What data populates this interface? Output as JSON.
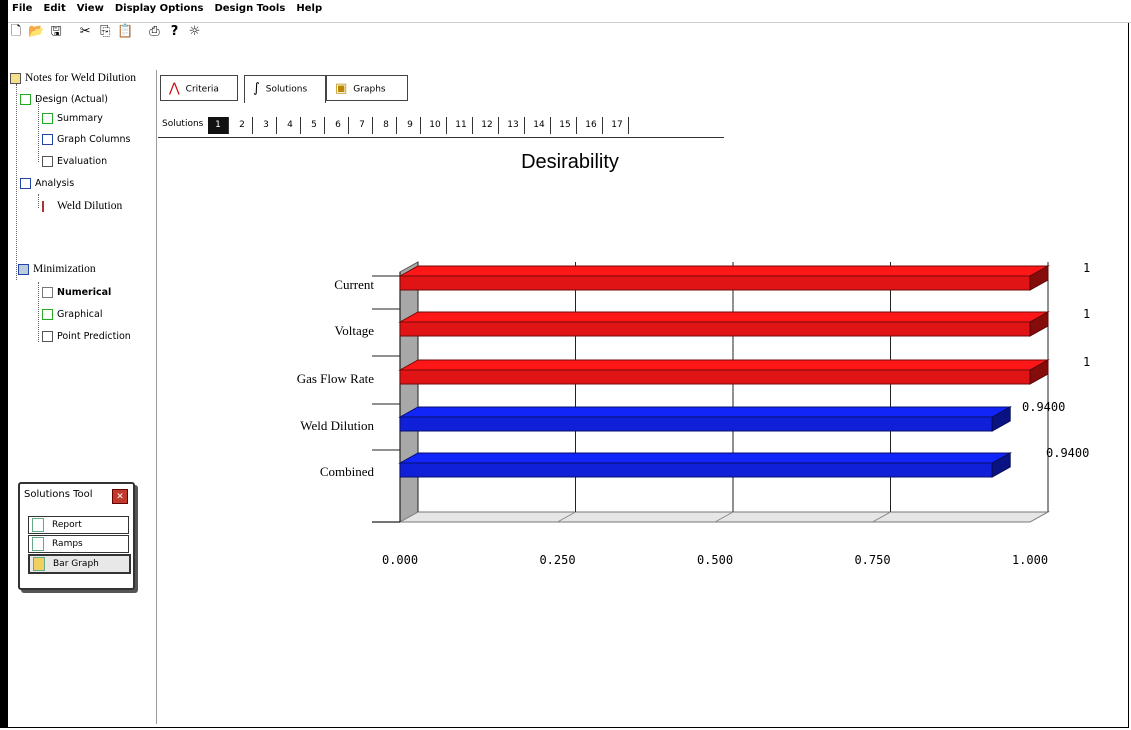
{
  "menu": [
    "File",
    "Edit",
    "View",
    "Display Options",
    "Design Tools",
    "Help"
  ],
  "toolbar_icons": [
    "new-icon",
    "open-icon",
    "save-icon",
    "cut-icon",
    "copy-icon",
    "paste-icon",
    "print-icon",
    "help-icon",
    "tip-icon"
  ],
  "tree": {
    "root": "Notes for Weld Dilution",
    "design": "Design (Actual)",
    "summary": "Summary",
    "graph_columns": "Graph Columns",
    "evaluation": "Evaluation",
    "analysis": "Analysis",
    "weld_dilution": "Weld Dilution",
    "minimization": "Minimization",
    "numerical": "Numerical",
    "graphical": "Graphical",
    "point_prediction": "Point Prediction"
  },
  "solutions_tool": {
    "title": "Solutions Tool",
    "buttons": [
      "Report",
      "Ramps",
      "Bar Graph"
    ]
  },
  "tabs": [
    "Criteria",
    "Solutions",
    "Graphs"
  ],
  "solutions": {
    "label": "Solutions",
    "numbers": [
      "1",
      "2",
      "3",
      "4",
      "5",
      "6",
      "7",
      "8",
      "9",
      "10",
      "11",
      "12",
      "13",
      "14",
      "15",
      "16",
      "17"
    ],
    "selected": "1"
  },
  "chart_data": {
    "type": "bar",
    "orientation": "horizontal",
    "title": "Desirability",
    "categories": [
      "Current",
      "Voltage",
      "Gas Flow Rate",
      "Weld Dilution",
      "Combined"
    ],
    "values": [
      1,
      1,
      1,
      0.94,
      0.94
    ],
    "value_labels": [
      "1",
      "1",
      "1",
      "0.9400",
      "0.9400"
    ],
    "colors": [
      "#e01414",
      "#e01414",
      "#e01414",
      "#1020d8",
      "#1020d8"
    ],
    "xlim": [
      0,
      1
    ],
    "xticks": [
      "0.000",
      "0.250",
      "0.500",
      "0.750",
      "1.000"
    ],
    "xlabel": "",
    "ylabel": "",
    "grid": true,
    "legend": "none"
  }
}
